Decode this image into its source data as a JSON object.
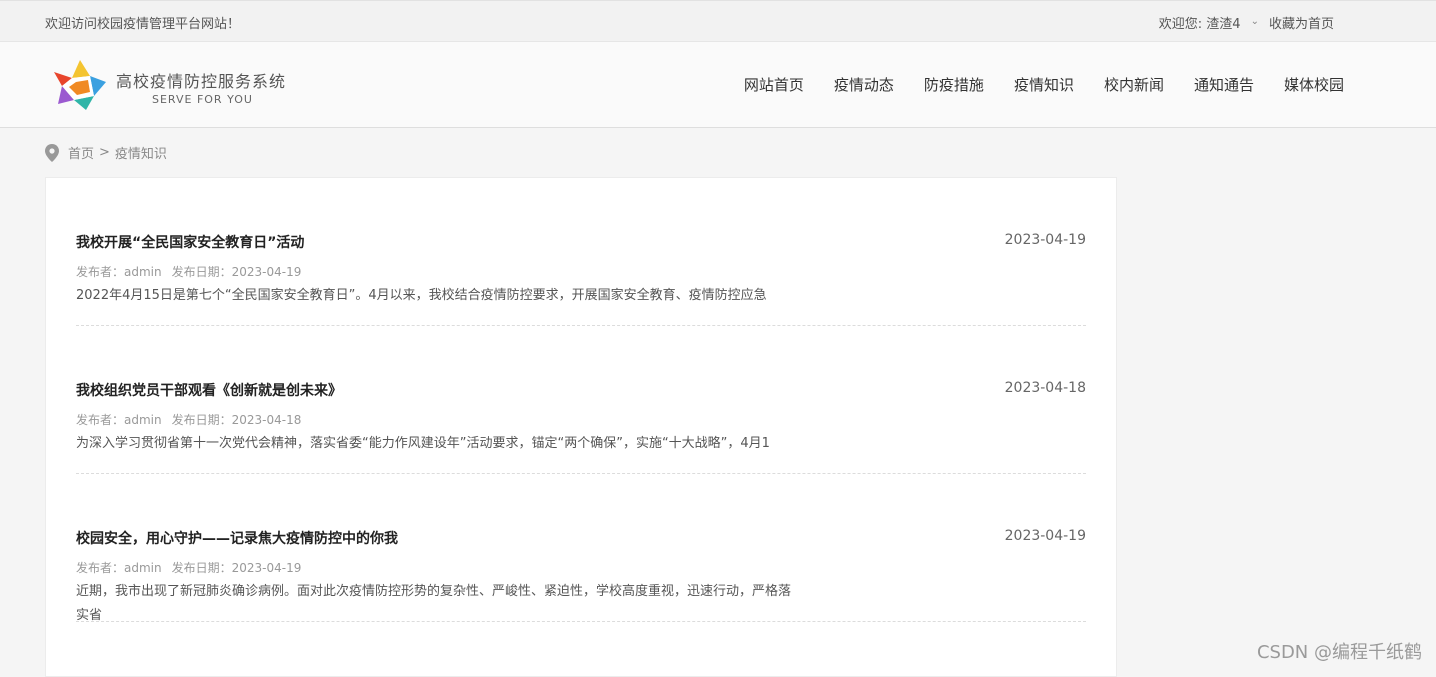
{
  "topbar": {
    "welcome": "欢迎访问校园疫情管理平台网站！",
    "user": "欢迎您: 渣渣4",
    "favorite": "收藏为首页"
  },
  "header": {
    "title": "高校疫情防控服务系统",
    "subtitle": "SERVE FOR YOU",
    "nav": [
      "网站首页",
      "疫情动态",
      "防疫措施",
      "疫情知识",
      "校内新闻",
      "通知通告",
      "媒体校园"
    ]
  },
  "breadcrumb": {
    "home": "首页",
    "separator": ">",
    "current": "疫情知识"
  },
  "articles": [
    {
      "title": "我校开展“全民国家安全教育日”活动",
      "date": "2023-04-19",
      "author": "发布者：admin",
      "published": "发布日期：2023-04-19",
      "summary": "2022年4月15日是第七个“全民国家安全教育日”。4月以来，我校结合疫情防控要求，开展国家安全教育、疫情防控应急"
    },
    {
      "title": "我校组织党员干部观看《创新就是创未来》",
      "date": "2023-04-18",
      "author": "发布者：admin",
      "published": "发布日期：2023-04-18",
      "summary": "为深入学习贯彻省第十一次党代会精神，落实省委“能力作风建设年”活动要求，锚定“两个确保”，实施“十大战略”，4月1"
    },
    {
      "title": "校园安全，用心守护——记录焦大疫情防控中的你我",
      "date": "2023-04-19",
      "author": "发布者：admin",
      "published": "发布日期：2023-04-19",
      "summary": "近期，我市出现了新冠肺炎确诊病例。面对此次疫情防控形势的复杂性、严峻性、紧迫性，学校高度重视，迅速行动，严格落实省"
    }
  ],
  "watermark": "CSDN @编程千纸鹤",
  "icons": {
    "user_menu": "chevron-down-icon",
    "breadcrumb": "location-pin-icon",
    "logo": "star-logo"
  }
}
